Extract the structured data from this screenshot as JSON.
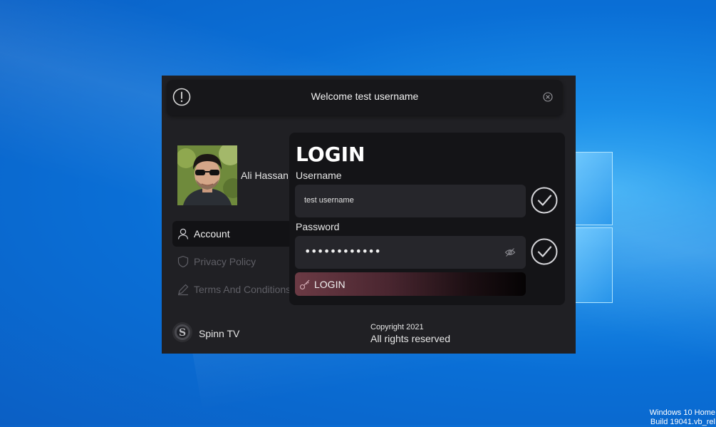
{
  "header": {
    "welcome_text": "Welcome test username"
  },
  "profile": {
    "name": "Ali Hassan"
  },
  "nav": {
    "items": [
      {
        "label": "Account",
        "icon": "user-icon",
        "active": true
      },
      {
        "label": "Privacy Policy",
        "icon": "shield-icon",
        "active": false
      },
      {
        "label": "Terms And Conditions",
        "icon": "pen-icon",
        "active": false
      }
    ]
  },
  "brand": {
    "name": "Spinn TV"
  },
  "footer": {
    "copyright": "Copyright 2021",
    "rights": "All rights reserved"
  },
  "login": {
    "title": "LOGIN",
    "username_label": "Username",
    "username_value": "test username",
    "password_label": "Password",
    "password_value": "••••••••••••",
    "button_label": "LOGIN"
  },
  "desktop": {
    "watermark_line1": "Windows 10 Home",
    "watermark_line2": "Build 19041.vb_rel"
  },
  "colors": {
    "app_bg": "#202024",
    "panel_bg": "#141417",
    "field_bg": "#26262b",
    "button_accent": "#6b3a44",
    "muted_text": "#5f5f66"
  }
}
